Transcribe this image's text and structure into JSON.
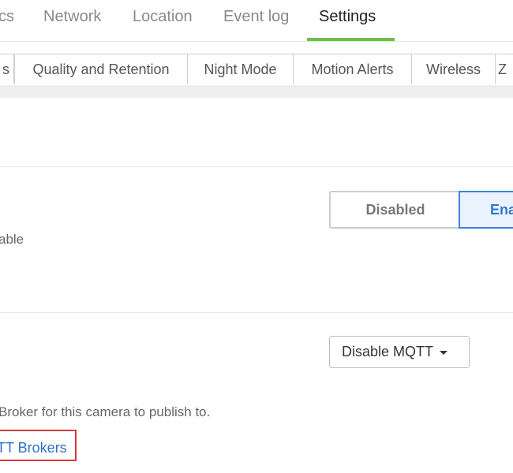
{
  "topnav": {
    "tabs": [
      {
        "label": "cs"
      },
      {
        "label": "Network"
      },
      {
        "label": "Location"
      },
      {
        "label": "Event log"
      },
      {
        "label": "Settings"
      }
    ],
    "active_color": "#6cc04a"
  },
  "subtabs": {
    "items": [
      {
        "label": "s"
      },
      {
        "label": "Quality and Retention"
      },
      {
        "label": "Night Mode"
      },
      {
        "label": "Motion Alerts"
      },
      {
        "label": "Wireless"
      },
      {
        "label": "Z"
      }
    ]
  },
  "section1": {
    "description_fragment": "able",
    "toggle": {
      "disabled_label": "Disabled",
      "enabled_label": "Ena",
      "selected": "Enabled"
    }
  },
  "section2": {
    "dropdown": {
      "selected": "Disable MQTT"
    },
    "description_fragment": "Broker for this camera to publish to.",
    "link_label": "TT Brokers"
  },
  "colors": {
    "accent_blue": "#2f78cf",
    "link_blue": "#2e72c7",
    "highlight_red": "#d9373b"
  }
}
